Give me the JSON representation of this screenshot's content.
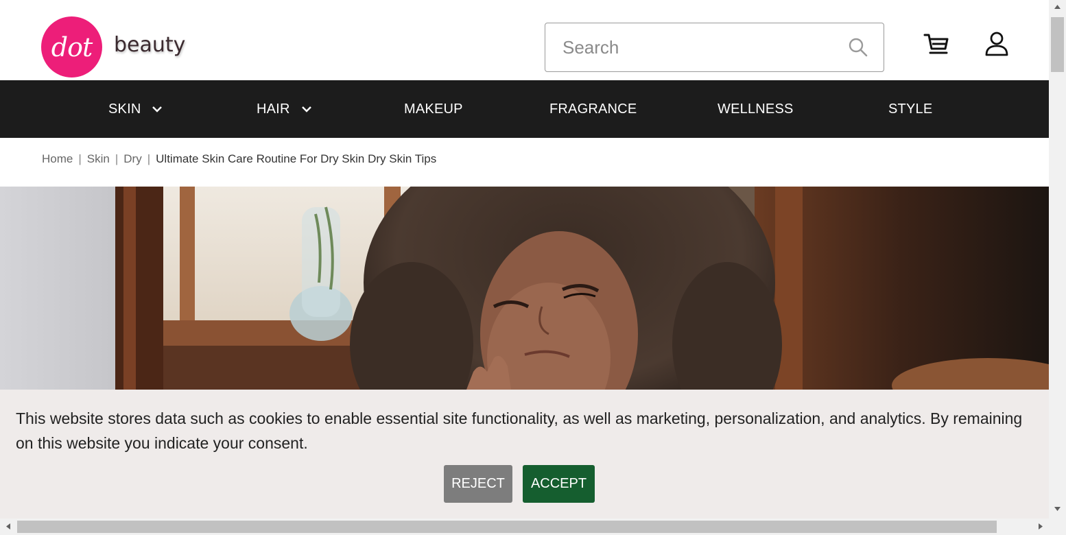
{
  "brand": {
    "logo_mark": "dot",
    "logo_word": "beauty",
    "accent": "#ed1e79"
  },
  "header": {
    "search_placeholder": "Search",
    "icons": [
      "search-icon",
      "cart-icon",
      "user-icon"
    ]
  },
  "nav": {
    "items": [
      {
        "label": "SKIN",
        "has_dropdown": true
      },
      {
        "label": "HAIR",
        "has_dropdown": true
      },
      {
        "label": "MAKEUP",
        "has_dropdown": false
      },
      {
        "label": "FRAGRANCE",
        "has_dropdown": false
      },
      {
        "label": "WELLNESS",
        "has_dropdown": false
      },
      {
        "label": "STYLE",
        "has_dropdown": false
      }
    ]
  },
  "breadcrumb": {
    "items": [
      "Home",
      "Skin",
      "Dry"
    ],
    "current": "Ultimate Skin Care Routine For Dry Skin Dry Skin Tips",
    "separator": "|"
  },
  "cookie_banner": {
    "text": "This website stores data such as cookies to enable essential site functionality, as well as marketing, personalization, and analytics. By remaining on this website you indicate your consent.",
    "reject_label": "REJECT",
    "accept_label": "ACCEPT",
    "reject_color": "#7d7d7d",
    "accept_color": "#155e2f"
  }
}
